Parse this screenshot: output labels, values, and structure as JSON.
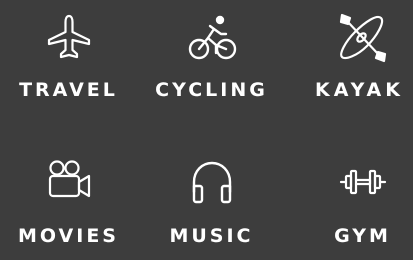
{
  "tiles": [
    {
      "label": "TRAVEL",
      "icon": "airplane-icon"
    },
    {
      "label": "CYCLING",
      "icon": "cyclist-icon"
    },
    {
      "label": "KAYAK",
      "icon": "kayak-icon"
    },
    {
      "label": "MOVIES",
      "icon": "movie-camera-icon"
    },
    {
      "label": "MUSIC",
      "icon": "headphones-icon"
    },
    {
      "label": "GYM",
      "icon": "dumbbell-icon"
    }
  ],
  "colors": {
    "background": "#3d3d3d",
    "foreground": "#ffffff"
  }
}
